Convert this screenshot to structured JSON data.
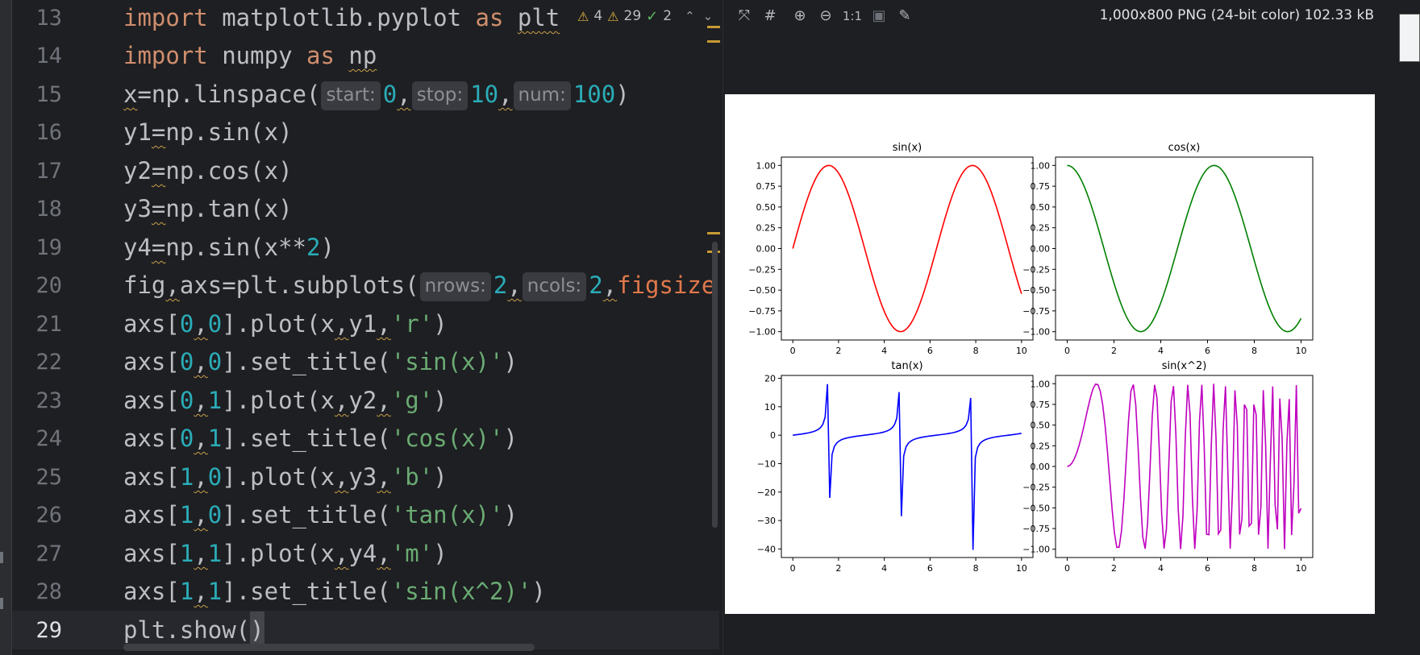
{
  "editor": {
    "line_numbers": [
      "13",
      "14",
      "15",
      "16",
      "17",
      "18",
      "19",
      "20",
      "21",
      "22",
      "23",
      "24",
      "25",
      "26",
      "27",
      "28",
      "29"
    ],
    "current_line": "29",
    "hints": {
      "start": "start:",
      "stop": "stop:",
      "num": "num:",
      "nrows": "nrows:",
      "ncols": "ncols:"
    },
    "inspections": {
      "warnings_a": "4",
      "warnings_b": "29",
      "ok": "2"
    }
  },
  "viewer": {
    "image_info": "1,000x800 PNG (24-bit color) 102.33 kB",
    "zoom_label": "1:1"
  },
  "chart_data": [
    {
      "type": "line",
      "title": "sin(x)",
      "series": [
        {
          "function": "sin(x)",
          "color": "#ff0000"
        }
      ],
      "x_range": [
        0,
        10
      ],
      "samples": 100,
      "xlim": [
        -0.5,
        10.5
      ],
      "ylim": [
        -1.1,
        1.1
      ],
      "xticks": [
        "0",
        "2",
        "4",
        "6",
        "8",
        "10"
      ],
      "yticks": [
        "−1.00",
        "−0.75",
        "−0.50",
        "−0.25",
        "0.00",
        "0.25",
        "0.50",
        "0.75",
        "1.00"
      ]
    },
    {
      "type": "line",
      "title": "cos(x)",
      "series": [
        {
          "function": "cos(x)",
          "color": "#008000"
        }
      ],
      "x_range": [
        0,
        10
      ],
      "samples": 100,
      "xlim": [
        -0.5,
        10.5
      ],
      "ylim": [
        -1.1,
        1.1
      ],
      "xticks": [
        "0",
        "2",
        "4",
        "6",
        "8",
        "10"
      ],
      "yticks": [
        "−1.00",
        "−0.75",
        "−0.50",
        "−0.25",
        "0.00",
        "0.25",
        "0.50",
        "0.75",
        "1.00"
      ]
    },
    {
      "type": "line",
      "title": "tan(x)",
      "series": [
        {
          "function": "tan(x)",
          "color": "#0000ff"
        }
      ],
      "x_range": [
        0,
        10
      ],
      "samples": 100,
      "xlim": [
        -0.5,
        10.5
      ],
      "ylim": [
        -43,
        21
      ],
      "xticks": [
        "0",
        "2",
        "4",
        "6",
        "8",
        "10"
      ],
      "yticks": [
        "−40",
        "−30",
        "−20",
        "−10",
        "0",
        "10",
        "20"
      ]
    },
    {
      "type": "line",
      "title": "sin(x^2)",
      "series": [
        {
          "function": "sin(x^2)",
          "color": "#bf00bf"
        }
      ],
      "x_range": [
        0,
        10
      ],
      "samples": 100,
      "xlim": [
        -0.5,
        10.5
      ],
      "ylim": [
        -1.1,
        1.1
      ],
      "xticks": [
        "0",
        "2",
        "4",
        "6",
        "8",
        "10"
      ],
      "yticks": [
        "−1.00",
        "−0.75",
        "−0.50",
        "−0.25",
        "0.00",
        "0.25",
        "0.50",
        "0.75",
        "1.00"
      ]
    }
  ]
}
